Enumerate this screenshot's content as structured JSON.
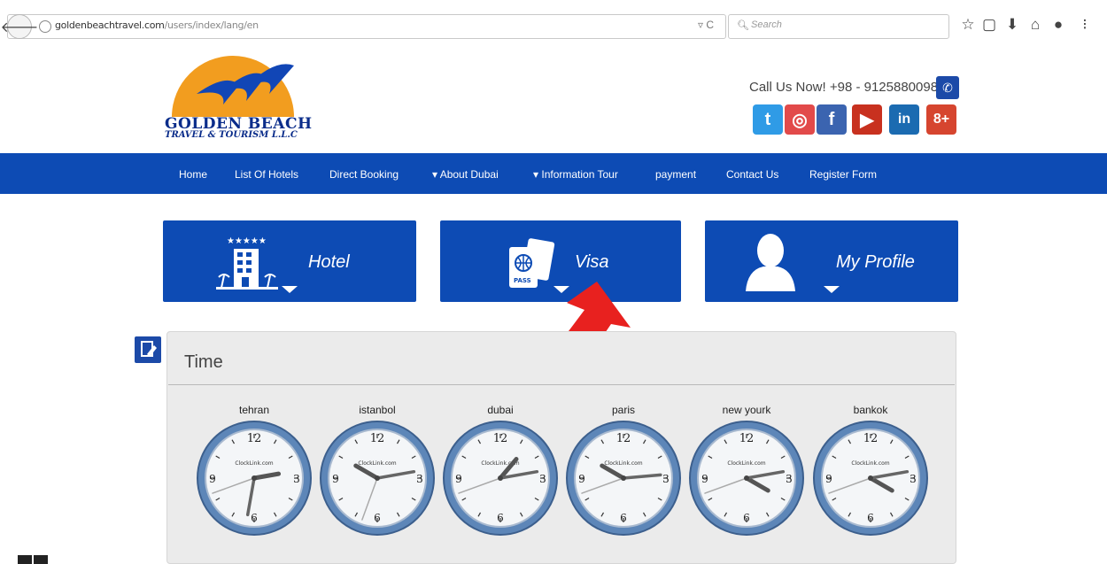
{
  "browser": {
    "url_host": "goldenbeachtravel.com",
    "url_path": "/users/index/lang/en",
    "search_placeholder": "Search"
  },
  "header": {
    "logo_line1": "GOLDEN BEACH",
    "logo_line2": "TRAVEL & TOURISM L.L.C",
    "call_text": "Call Us Now! +98 - 9125880098",
    "social": [
      {
        "name": "twitter",
        "glyph": "t",
        "color": "#2f9be6"
      },
      {
        "name": "instagram",
        "glyph": "◎",
        "color": "#e24a4a"
      },
      {
        "name": "facebook",
        "glyph": "f",
        "color": "#3b64b0"
      },
      {
        "name": "youtube",
        "glyph": "▶",
        "color": "#c8311f"
      },
      {
        "name": "linkedin",
        "glyph": "in",
        "color": "#1b6bb1"
      },
      {
        "name": "googleplus",
        "glyph": "8+",
        "color": "#d6452f"
      }
    ]
  },
  "nav": {
    "home": "Home",
    "hotels": "List Of Hotels",
    "direct_booking": "Direct Booking",
    "about_dubai": "▾ About Dubai",
    "information_tour": "▾ Information Tour",
    "payment": "payment",
    "contact": "Contact Us",
    "register": "Register Form"
  },
  "tiles": {
    "hotel": "Hotel",
    "visa": "Visa",
    "profile": "My Profile",
    "visa_pass": "PASS"
  },
  "time_panel": {
    "title": "Time",
    "clock_brand": "ClockLink.com",
    "cities": [
      "tehran",
      "istanbol",
      "dubai",
      "paris",
      "new yourk",
      "bankok"
    ]
  }
}
